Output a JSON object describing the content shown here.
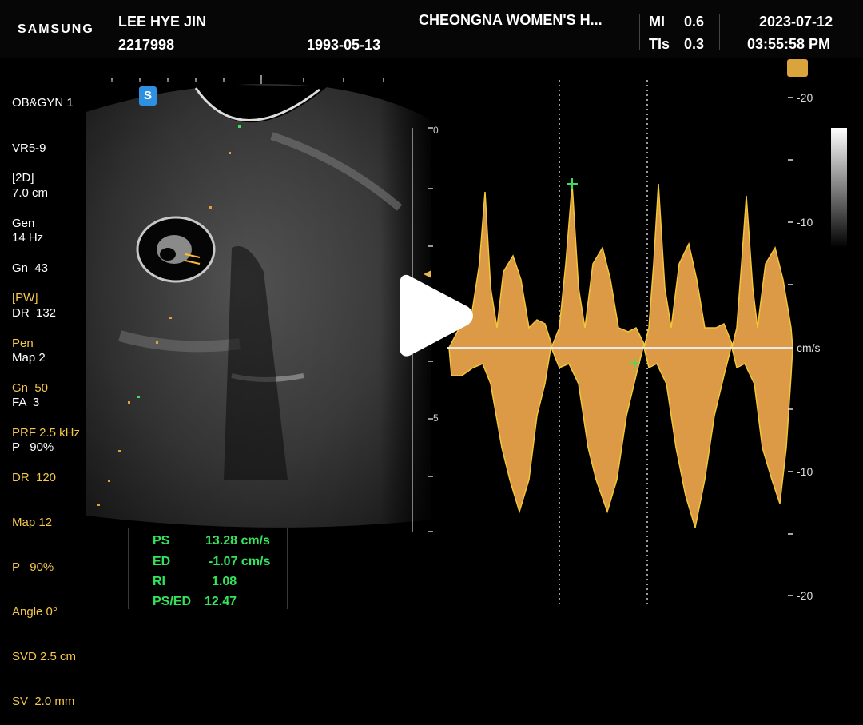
{
  "header": {
    "brand": "SAMSUNG",
    "patient_name": "LEE HYE JIN",
    "patient_id": "2217998",
    "birth_date": "1993-05-13",
    "institution": "CHEONGNA WOMEN'S H...",
    "mi_label": "MI",
    "mi_value": "0.6",
    "tis_label": "TIs",
    "tis_value": "0.3",
    "date": "2023-07-12",
    "time": "03:55:58 PM"
  },
  "probe": {
    "preset": "OB&GYN 1",
    "transducer": "VR5-9",
    "depth": "7.0 cm",
    "frame_rate": "14 Hz"
  },
  "mode_2d": {
    "title": "[2D]",
    "items": [
      "Gen",
      "Gn  43",
      "DR  132",
      "Map 2",
      "FA  3",
      "P   90%"
    ]
  },
  "mode_pw": {
    "title": "[PW]",
    "items": [
      "Pen",
      "Gn  50",
      "PRF 2.5 kHz",
      "DR  120",
      "Map 12",
      "P   90%",
      "Angle 0°",
      "SVD 2.5 cm",
      "SV  2.0 mm"
    ]
  },
  "badge_label": "S",
  "depth_scale": [
    "0",
    "5"
  ],
  "doppler_scale": {
    "unit": "cm/s",
    "ticks": [
      "-20",
      "-10",
      "-10",
      "-20"
    ]
  },
  "measurements": [
    {
      "label": "PS",
      "value": "13.28 cm/s"
    },
    {
      "label": "ED",
      "value": "-1.07 cm/s"
    },
    {
      "label": "RI",
      "value": "1.08"
    },
    {
      "label": "PS/ED",
      "value": "12.47"
    }
  ],
  "colors": {
    "waveform": "#e8a24a",
    "waveform_edge": "#ffd23a",
    "measure_text": "#33e35a",
    "info_yellow": "#f5c84a"
  },
  "icons": [
    "play-icon",
    "sweep-speed-icon",
    "scan-badge-icon"
  ]
}
